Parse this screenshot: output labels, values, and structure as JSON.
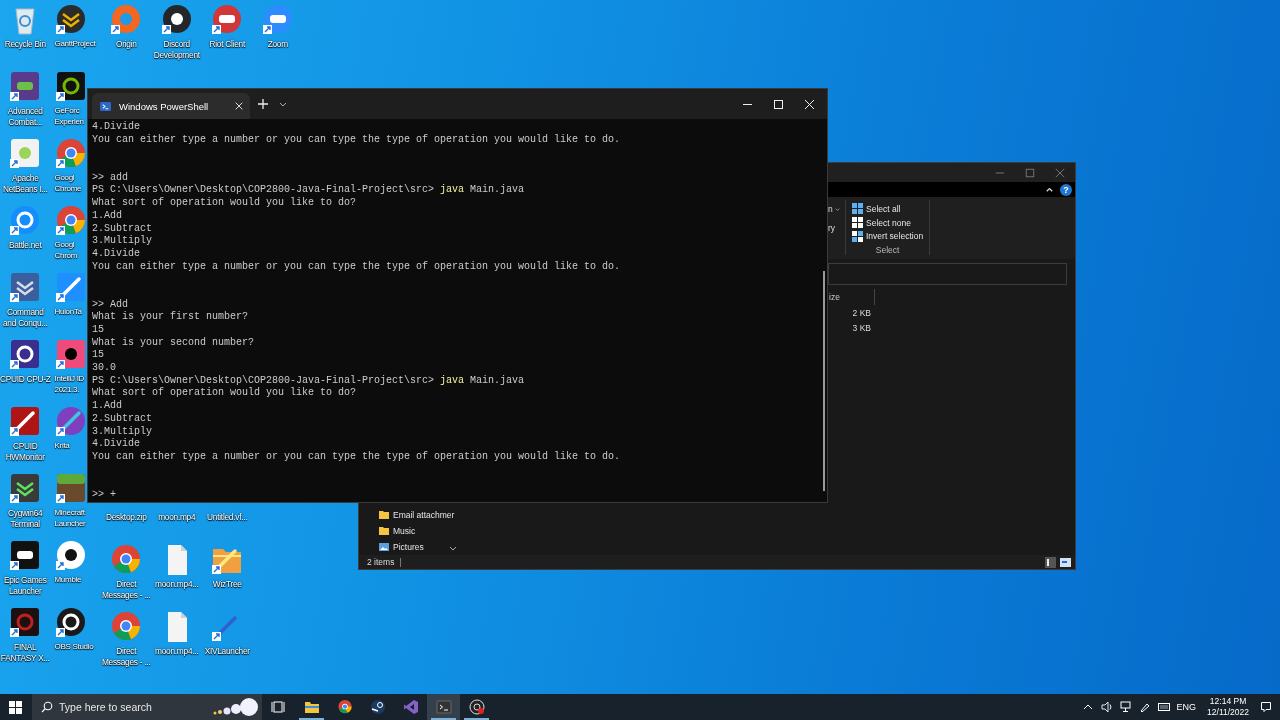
{
  "desktop": {
    "columns": [
      {
        "top": [
          {
            "label": "Recycle Bin",
            "kind": "bin",
            "shortcut": false
          },
          {
            "label": "Advanced\nCombat...",
            "kind": "act",
            "shortcut": true
          },
          {
            "label": "Apache\nNetBeans I...",
            "kind": "netbeans",
            "shortcut": true
          },
          {
            "label": "Battle.net",
            "kind": "battlenet",
            "shortcut": true
          },
          {
            "label": "Command\nand Conqu...",
            "kind": "cnc",
            "shortcut": true
          },
          {
            "label": "CPUID CPU-Z",
            "kind": "cpuz",
            "shortcut": true
          },
          {
            "label": "CPUID\nHWMonitor",
            "kind": "hwmonitor",
            "shortcut": true
          },
          {
            "label": "Cygwin64\nTerminal",
            "kind": "cygwin",
            "shortcut": true
          },
          {
            "label": "Epic Games\nLauncher",
            "kind": "epic",
            "shortcut": true
          },
          {
            "label": "FINAL\nFANTASY X...",
            "kind": "ffxiv",
            "shortcut": true
          }
        ]
      },
      {
        "top": [
          {
            "label": "GanttProject",
            "kind": "gantt",
            "shortcut": true
          },
          {
            "label": "GeForc\nExperien",
            "kind": "geforce",
            "shortcut": true
          },
          {
            "label": "Googl\nChrome",
            "kind": "chrome-dev",
            "shortcut": true
          },
          {
            "label": "Googl\nChrom",
            "kind": "chrome",
            "shortcut": true
          },
          {
            "label": "HuionTa",
            "kind": "huion",
            "shortcut": true
          },
          {
            "label": "IntelliJ ID\n2021.3.",
            "kind": "intellij",
            "shortcut": true
          },
          {
            "label": "Krita",
            "kind": "krita",
            "shortcut": true
          },
          {
            "label": "Minecraft\nLauncher",
            "kind": "minecraft",
            "shortcut": true
          },
          {
            "label": "Mumble",
            "kind": "mumble",
            "shortcut": true
          },
          {
            "label": "OBS Studio",
            "kind": "obs",
            "shortcut": true
          }
        ]
      },
      {
        "top": [
          {
            "label": "Origin",
            "kind": "origin",
            "shortcut": true
          }
        ],
        "bottom": [
          {
            "label": "Desktop.zip"
          },
          {
            "label": "Direct\nMessages - ...",
            "kind": "chrome-dev",
            "shortcut": false
          },
          {
            "label": "Direct\nMessages - ...",
            "kind": "chrome-dev",
            "shortcut": false
          }
        ]
      },
      {
        "top": [
          {
            "label": "Discord\nDevelopment",
            "kind": "discord",
            "shortcut": true
          }
        ],
        "bottom": [
          {
            "label": "moon.mp4"
          },
          {
            "label": "moon.mp4...",
            "kind": "file",
            "shortcut": false
          },
          {
            "label": "moon.mp4...",
            "kind": "file",
            "shortcut": false
          }
        ]
      },
      {
        "top": [
          {
            "label": "Riot Client",
            "kind": "riot",
            "shortcut": true
          }
        ],
        "bottom": [
          {
            "label": "Untitled.vf..."
          },
          {
            "label": "WizTree",
            "kind": "wiztree",
            "shortcut": true
          },
          {
            "label": "XIVLauncher",
            "kind": "xiv",
            "shortcut": true
          }
        ]
      },
      {
        "top": [
          {
            "label": "Zoom",
            "kind": "zoom",
            "shortcut": true
          }
        ]
      }
    ]
  },
  "explorer": {
    "help_glyph": "?",
    "cut_items": [
      "n",
      "ry"
    ],
    "select_group": {
      "items": [
        "Select all",
        "Select none",
        "Invert selection"
      ],
      "label": "Select"
    },
    "column_header": "ize",
    "rows": [
      {
        "size": "2 KB"
      },
      {
        "size": "3 KB"
      }
    ],
    "nav": [
      {
        "label": "Email attachmer",
        "kind": "folder"
      },
      {
        "label": "Music",
        "kind": "folder"
      },
      {
        "label": "Pictures",
        "kind": "pictures"
      }
    ],
    "status": "2 items"
  },
  "terminal": {
    "tab": {
      "title": "Windows PowerShell",
      "selected": true
    },
    "lines": [
      {
        "kind": "out",
        "text": "4.Divide"
      },
      {
        "kind": "out",
        "text": "You can either type a number or you can type the type of operation you would like to do."
      },
      {
        "kind": "blank"
      },
      {
        "kind": "blank"
      },
      {
        "kind": "out",
        "text": ">> add"
      },
      {
        "kind": "cmd",
        "prompt": "PS C:\\Users\\Owner\\Desktop\\COP2800-Java-Final-Project\\src>",
        "command": "java",
        "args": "Main.java"
      },
      {
        "kind": "out",
        "text": "What sort of operation would you like to do?"
      },
      {
        "kind": "out",
        "text": "1.Add"
      },
      {
        "kind": "out",
        "text": "2.Subtract"
      },
      {
        "kind": "out",
        "text": "3.Multiply"
      },
      {
        "kind": "out",
        "text": "4.Divide"
      },
      {
        "kind": "out",
        "text": "You can either type a number or you can type the type of operation you would like to do."
      },
      {
        "kind": "blank"
      },
      {
        "kind": "blank"
      },
      {
        "kind": "out",
        "text": ">> Add"
      },
      {
        "kind": "out",
        "text": "What is your first number?"
      },
      {
        "kind": "out",
        "text": "15"
      },
      {
        "kind": "out",
        "text": "What is your second number?"
      },
      {
        "kind": "out",
        "text": "15"
      },
      {
        "kind": "out",
        "text": "30.0"
      },
      {
        "kind": "cmd",
        "prompt": "PS C:\\Users\\Owner\\Desktop\\COP2800-Java-Final-Project\\src>",
        "command": "java",
        "args": "Main.java"
      },
      {
        "kind": "out",
        "text": "What sort of operation would you like to do?"
      },
      {
        "kind": "out",
        "text": "1.Add"
      },
      {
        "kind": "out",
        "text": "2.Subtract"
      },
      {
        "kind": "out",
        "text": "3.Multiply"
      },
      {
        "kind": "out",
        "text": "4.Divide"
      },
      {
        "kind": "out",
        "text": "You can either type a number or you can type the type of operation you would like to do."
      },
      {
        "kind": "blank"
      },
      {
        "kind": "blank"
      },
      {
        "kind": "out",
        "text": ">> +"
      }
    ]
  },
  "taskbar": {
    "search": {
      "placeholder": "Type here to search"
    },
    "apps": [
      {
        "kind": "task-view",
        "running": false,
        "selected": false
      },
      {
        "kind": "explorer",
        "running": true,
        "selected": false
      },
      {
        "kind": "chrome-dev",
        "running": false,
        "selected": false
      },
      {
        "kind": "steam",
        "running": false,
        "selected": false
      },
      {
        "kind": "vs",
        "running": false,
        "selected": false
      },
      {
        "kind": "terminal",
        "running": true,
        "selected": true
      },
      {
        "kind": "obs",
        "running": true,
        "selected": false
      }
    ],
    "tray": {
      "language": "ENG",
      "time": "12:14 PM",
      "date": "12/11/2022"
    }
  }
}
